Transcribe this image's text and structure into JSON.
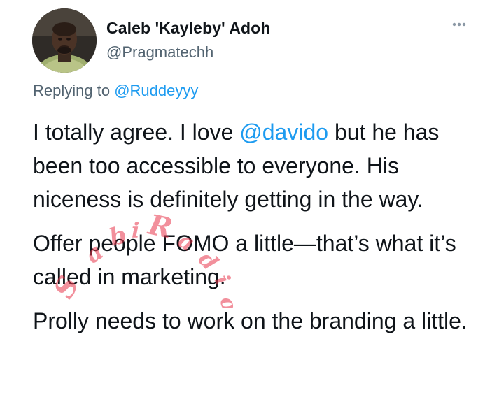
{
  "tweet": {
    "author": {
      "name": "Caleb 'Kayleby' Adoh",
      "handle": "@Pragmatechh"
    },
    "more_icon": "more-dots-icon",
    "reply": {
      "prefix": "Replying to ",
      "mention": "@Ruddeyyy"
    },
    "body": {
      "p1_before": "I totally agree. I love ",
      "p1_mention": "@davido",
      "p1_after": " but he has been too accessible to everyone. His niceness is definitely getting in the way.",
      "p2": "Offer people FOMO a little—that’s what it’s called in marketing.",
      "p3": "Prolly needs to work on the branding a little."
    },
    "watermark": "SabiRadio"
  },
  "colors": {
    "text": "#0f1419",
    "secondary": "#536471",
    "link": "#1d9bf0",
    "watermark": "#e8344a"
  }
}
